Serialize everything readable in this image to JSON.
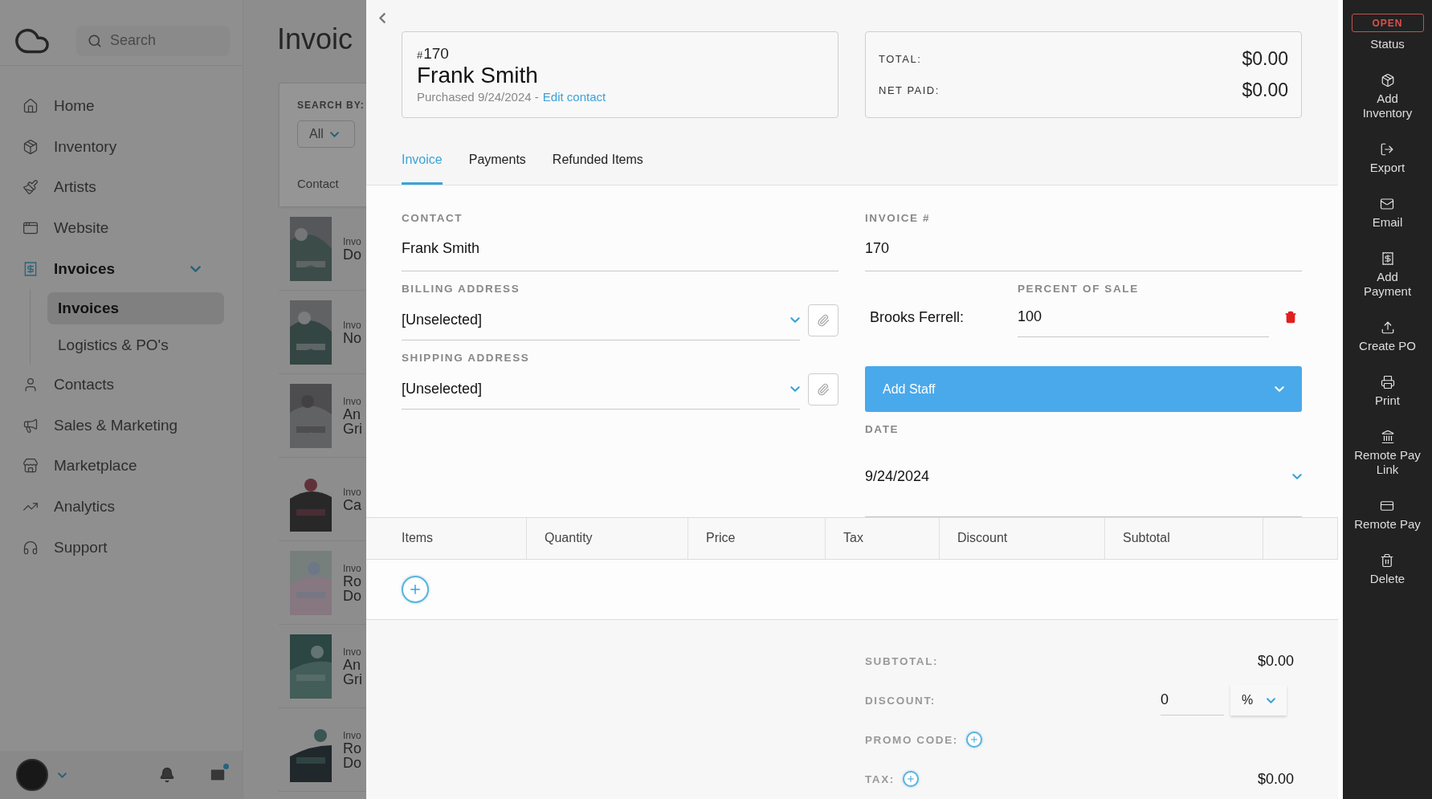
{
  "sidebar": {
    "search": {
      "placeholder": "Search"
    },
    "nav": [
      {
        "label": "Home",
        "selected": false
      },
      {
        "label": "Inventory",
        "selected": false
      },
      {
        "label": "Artists",
        "selected": false
      },
      {
        "label": "Website",
        "selected": false
      },
      {
        "label": "Invoices",
        "selected": true,
        "expanded": true,
        "children": [
          {
            "label": "Invoices",
            "selected": true
          },
          {
            "label": "Logistics & PO's",
            "selected": false
          }
        ]
      },
      {
        "label": "Contacts",
        "selected": false
      },
      {
        "label": "Sales & Marketing",
        "selected": false
      },
      {
        "label": "Marketplace",
        "selected": false
      },
      {
        "label": "Analytics",
        "selected": false
      },
      {
        "label": "Support",
        "selected": false
      }
    ],
    "mail_unread": true
  },
  "invoice_list": {
    "title": "Invoic",
    "search_by": "SEARCH BY:",
    "filter": "All",
    "column": "Contact",
    "rows": [
      {
        "label": "Invo",
        "title": [
          "Do"
        ]
      },
      {
        "label": "Invo",
        "title": [
          "No"
        ]
      },
      {
        "label": "Invo",
        "title": [
          "An",
          "Gri"
        ]
      },
      {
        "label": "Invo",
        "title": [
          "Ca"
        ]
      },
      {
        "label": "Invo",
        "title": [
          "Ro",
          "Do"
        ]
      },
      {
        "label": "Invo",
        "title": [
          "An",
          "Gri"
        ]
      },
      {
        "label": "Invo",
        "title": [
          "Ro",
          "Do"
        ]
      }
    ]
  },
  "invoice": {
    "hash": "#",
    "number": "170",
    "contact_name": "Frank Smith",
    "purchased": "Purchased 9/24/2024 -",
    "edit_link": "Edit contact",
    "totals": [
      {
        "label": "TOTAL:",
        "value": "$0.00"
      },
      {
        "label": "NET PAID:",
        "value": "$0.00"
      }
    ],
    "tabs": [
      {
        "label": "Invoice",
        "selected": true
      },
      {
        "label": "Payments",
        "selected": false
      },
      {
        "label": "Refunded Items",
        "selected": false
      }
    ],
    "form": {
      "contact": {
        "label": "CONTACT",
        "value": "Frank Smith"
      },
      "billing": {
        "label": "BILLING ADDRESS",
        "value": "[Unselected]"
      },
      "shipping": {
        "label": "SHIPPING ADDRESS",
        "value": "[Unselected]"
      },
      "invoice_number": {
        "label": "INVOICE #",
        "value": "170"
      },
      "percent_label": "PERCENT OF SALE",
      "staff": [
        {
          "name": "Brooks Ferrell:",
          "percent": "100"
        }
      ],
      "add_staff": "Add Staff",
      "date": {
        "label": "DATE",
        "value": "9/24/2024"
      }
    },
    "items_table": {
      "columns": [
        "Items",
        "Quantity",
        "Price",
        "Tax",
        "Discount",
        "Subtotal"
      ]
    },
    "summary": [
      {
        "kind": "amount",
        "label": "SUBTOTAL:",
        "value": "$0.00"
      },
      {
        "kind": "discount",
        "label": "DISCOUNT:",
        "value": "0",
        "unit": "%"
      },
      {
        "kind": "add",
        "label": "PROMO CODE:"
      },
      {
        "kind": "add",
        "label": "TAX:",
        "value": "$0.00"
      }
    ]
  },
  "actions": {
    "status": {
      "badge": "OPEN",
      "label": "Status"
    },
    "items": [
      "Add Inventory",
      "Export",
      "Email",
      "Add Payment",
      "Create PO",
      "Print",
      "Remote Pay Link",
      "Remote Pay",
      "Delete"
    ]
  }
}
